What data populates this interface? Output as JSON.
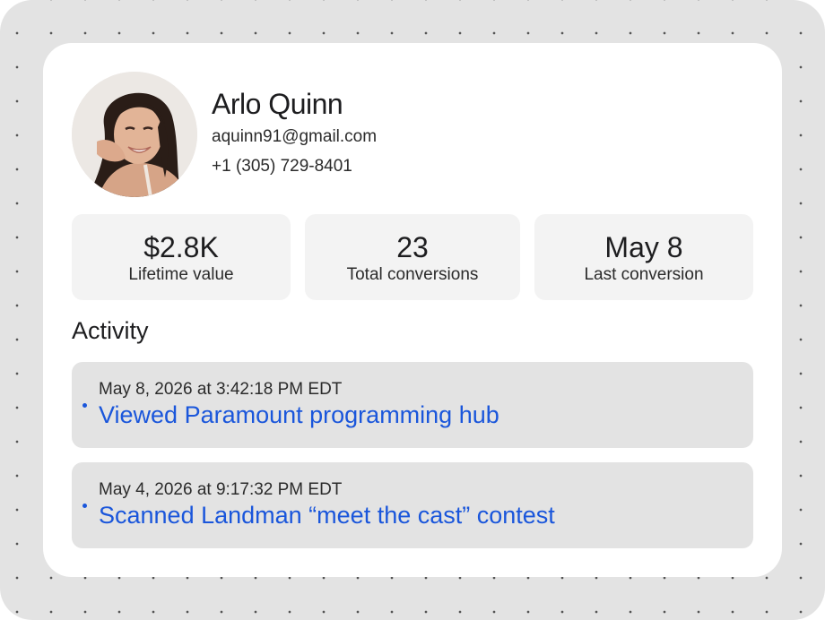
{
  "profile": {
    "name": "Arlo Quinn",
    "email": "aquinn91@gmail.com",
    "phone": "+1 (305) 729-8401"
  },
  "stats": [
    {
      "value": "$2.8K",
      "label": "Lifetime value"
    },
    {
      "value": "23",
      "label": "Total conversions"
    },
    {
      "value": "May 8",
      "label": "Last conversion"
    }
  ],
  "activity": {
    "heading": "Activity",
    "items": [
      {
        "time": "May 8, 2026 at 3:42:18 PM EDT",
        "text": "Viewed Paramount programming hub"
      },
      {
        "time": "May 4, 2026 at 9:17:32 PM EDT",
        "text": "Scanned Landman “meet the cast” contest"
      }
    ]
  },
  "colors": {
    "link": "#1a56db",
    "page_background": "#e3e3e3",
    "card_background": "#ffffff",
    "stat_background": "#f3f3f3",
    "activity_background": "#e3e3e3"
  }
}
